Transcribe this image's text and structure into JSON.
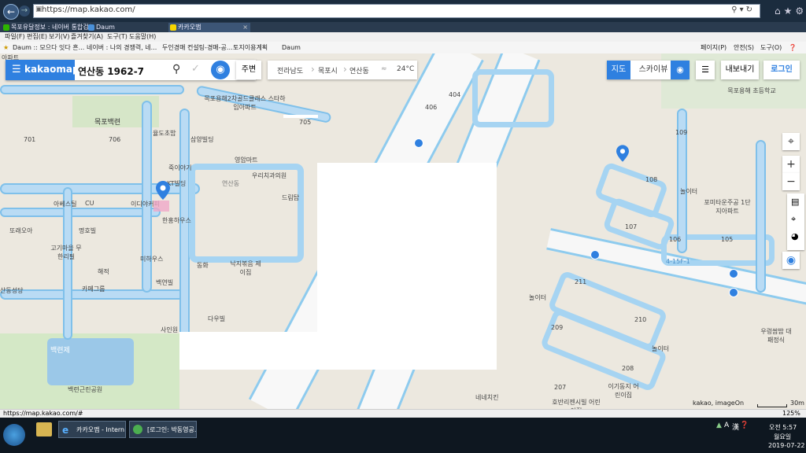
{
  "browser": {
    "url": "https://map.kakao.com/",
    "tabs": [
      {
        "label": "목포유달정보 : 네이버 통합검색",
        "color": "#2db400"
      },
      {
        "label": "Daum",
        "color": "#4a90d9"
      },
      {
        "label": "카카오맵",
        "color": "#f7d500"
      }
    ],
    "menu": [
      "파일(F)",
      "편집(E)",
      "보기(V)",
      "즐겨찾기(A)",
      "도구(T)",
      "도움말(H)"
    ],
    "favorites": [
      "Daum :: 모으다 잇다 흔...",
      "네이버 : 나의 경쟁력, 네...",
      "두인경매 컨설팅-경매-공...",
      "토지이용계획",
      "Daum"
    ],
    "toolbar_right": [
      "페이지(P)",
      "안전(S)",
      "도구(O)"
    ],
    "status_url": "https://map.kakao.com/#",
    "zoom": "125%"
  },
  "kakaomap": {
    "logo": "kakaomap",
    "search_value": "연산동 1962-7",
    "nearby_label": "주변",
    "breadcrumb": [
      "전라남도",
      "목포시",
      "연산동"
    ],
    "weather": "24°C",
    "map_label": "지도",
    "skyview_label": "스카이뷰",
    "export_label": "내보내기",
    "login_label": "로그인",
    "brand_color": "#2f80e0",
    "copyright": "kakao, imageOn",
    "scale": "30m"
  },
  "map_labels": {
    "top_left": [
      "아파트",
      "목포백련",
      "701",
      "706",
      "율도초밥",
      "삼양빌딩",
      "영암마트",
      "죽이야기",
      "KT빌딩",
      "이디야커피",
      "CU",
      "아베스틸",
      "한홍하우스",
      "또래오아",
      "명호빌",
      "고기마을 무한리필",
      "해적",
      "미하우스",
      "동화",
      "백연빌",
      "산동성당",
      "카페그룹",
      "사인원",
      "다우빌",
      "낙지볶음 제이집",
      "우리치과의원",
      "드림탑",
      "목포용해2차골드클래스 스타하임아파트",
      "705",
      "백련제",
      "백련근린공원",
      "연산동"
    ],
    "right": [
      "목포용해 초등학교",
      "109",
      "108",
      "107",
      "106",
      "105",
      "놀이터",
      "포미타운주공 1단지아파트",
      "놀이터",
      "211",
      "210",
      "209",
      "208",
      "207",
      "놀이터",
      "우렁쌈밥 대패정식",
      "이기동지 어린이집",
      "호반리젠시빌 어린이집",
      "네네치킨",
      "404",
      "406",
      "4-15F-1"
    ]
  },
  "taskbar": {
    "items": [
      "카카오맵 - Intern...",
      "[로그인: 박동영공..."
    ],
    "tray_icons": [
      "A",
      "漢"
    ],
    "time": "오전 5:57",
    "day": "월요일",
    "date": "2019-07-22"
  }
}
